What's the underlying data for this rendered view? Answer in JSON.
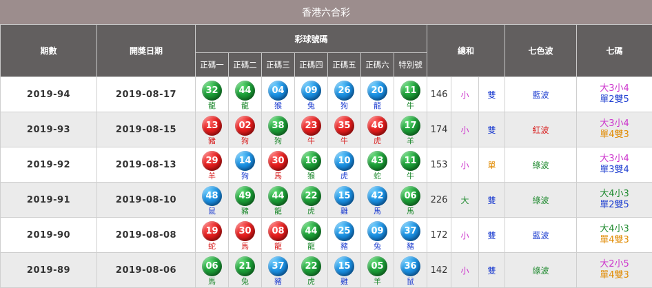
{
  "title": "香港六合彩",
  "headers": {
    "issue": "期數",
    "date": "開獎日期",
    "balls": "彩球號碼",
    "ball_cols": [
      "正碼一",
      "正碼二",
      "正碼三",
      "正碼四",
      "正碼五",
      "正碼六",
      "特別號"
    ],
    "sum": "總和",
    "wave": "七色波",
    "qima": "七碼"
  },
  "rows": [
    {
      "issue": "2019-94",
      "date": "2019-08-17",
      "balls": [
        {
          "num": "32",
          "zodiac": "龍",
          "color": "green"
        },
        {
          "num": "44",
          "zodiac": "龍",
          "color": "green"
        },
        {
          "num": "04",
          "zodiac": "猴",
          "color": "blue"
        },
        {
          "num": "09",
          "zodiac": "兔",
          "color": "blue"
        },
        {
          "num": "26",
          "zodiac": "狗",
          "color": "blue"
        },
        {
          "num": "20",
          "zodiac": "龍",
          "color": "blue"
        },
        {
          "num": "11",
          "zodiac": "牛",
          "color": "green"
        }
      ],
      "sum": "146",
      "size": "小",
      "parity": "雙",
      "wave": "藍波",
      "wave_color": "blue",
      "qima1": "大3小4",
      "qima2": "單2雙5",
      "q1color": "magenta",
      "q2color": "blue"
    },
    {
      "issue": "2019-93",
      "date": "2019-08-15",
      "balls": [
        {
          "num": "13",
          "zodiac": "豬",
          "color": "red"
        },
        {
          "num": "02",
          "zodiac": "狗",
          "color": "red"
        },
        {
          "num": "38",
          "zodiac": "狗",
          "color": "green"
        },
        {
          "num": "23",
          "zodiac": "牛",
          "color": "red"
        },
        {
          "num": "35",
          "zodiac": "牛",
          "color": "red"
        },
        {
          "num": "46",
          "zodiac": "虎",
          "color": "red"
        },
        {
          "num": "17",
          "zodiac": "羊",
          "color": "green"
        }
      ],
      "sum": "174",
      "size": "小",
      "parity": "雙",
      "wave": "紅波",
      "wave_color": "red",
      "qima1": "大3小4",
      "qima2": "單4雙3",
      "q1color": "magenta",
      "q2color": "orange"
    },
    {
      "issue": "2019-92",
      "date": "2019-08-13",
      "balls": [
        {
          "num": "29",
          "zodiac": "羊",
          "color": "red"
        },
        {
          "num": "14",
          "zodiac": "狗",
          "color": "blue"
        },
        {
          "num": "30",
          "zodiac": "馬",
          "color": "red"
        },
        {
          "num": "16",
          "zodiac": "猴",
          "color": "green"
        },
        {
          "num": "10",
          "zodiac": "虎",
          "color": "blue"
        },
        {
          "num": "43",
          "zodiac": "蛇",
          "color": "green"
        },
        {
          "num": "11",
          "zodiac": "牛",
          "color": "green"
        }
      ],
      "sum": "153",
      "size": "小",
      "parity": "單",
      "wave": "綠波",
      "wave_color": "green",
      "qima1": "大3小4",
      "qima2": "單3雙4",
      "q1color": "magenta",
      "q2color": "blue"
    },
    {
      "issue": "2019-91",
      "date": "2019-08-10",
      "balls": [
        {
          "num": "48",
          "zodiac": "鼠",
          "color": "blue"
        },
        {
          "num": "49",
          "zodiac": "豬",
          "color": "green"
        },
        {
          "num": "44",
          "zodiac": "龍",
          "color": "green"
        },
        {
          "num": "22",
          "zodiac": "虎",
          "color": "green"
        },
        {
          "num": "15",
          "zodiac": "雞",
          "color": "blue"
        },
        {
          "num": "42",
          "zodiac": "馬",
          "color": "blue"
        },
        {
          "num": "06",
          "zodiac": "馬",
          "color": "green"
        }
      ],
      "sum": "226",
      "size": "大",
      "parity": "雙",
      "wave": "綠波",
      "wave_color": "green",
      "qima1": "大4小3",
      "qima2": "單2雙5",
      "q1color": "green",
      "q2color": "blue"
    },
    {
      "issue": "2019-90",
      "date": "2019-08-08",
      "balls": [
        {
          "num": "19",
          "zodiac": "蛇",
          "color": "red"
        },
        {
          "num": "30",
          "zodiac": "馬",
          "color": "red"
        },
        {
          "num": "08",
          "zodiac": "龍",
          "color": "red"
        },
        {
          "num": "44",
          "zodiac": "龍",
          "color": "green"
        },
        {
          "num": "25",
          "zodiac": "豬",
          "color": "blue"
        },
        {
          "num": "09",
          "zodiac": "兔",
          "color": "blue"
        },
        {
          "num": "37",
          "zodiac": "豬",
          "color": "blue"
        }
      ],
      "sum": "172",
      "size": "小",
      "parity": "雙",
      "wave": "藍波",
      "wave_color": "blue",
      "qima1": "大4小3",
      "qima2": "單4雙3",
      "q1color": "green",
      "q2color": "orange"
    },
    {
      "issue": "2019-89",
      "date": "2019-08-06",
      "balls": [
        {
          "num": "06",
          "zodiac": "馬",
          "color": "green"
        },
        {
          "num": "21",
          "zodiac": "兔",
          "color": "green"
        },
        {
          "num": "37",
          "zodiac": "豬",
          "color": "blue"
        },
        {
          "num": "22",
          "zodiac": "虎",
          "color": "green"
        },
        {
          "num": "15",
          "zodiac": "雞",
          "color": "blue"
        },
        {
          "num": "05",
          "zodiac": "羊",
          "color": "green"
        },
        {
          "num": "36",
          "zodiac": "鼠",
          "color": "blue"
        }
      ],
      "sum": "142",
      "size": "小",
      "parity": "雙",
      "wave": "綠波",
      "wave_color": "green",
      "qima1": "大2小5",
      "qima2": "單4雙3",
      "q1color": "magenta",
      "q2color": "orange"
    }
  ]
}
